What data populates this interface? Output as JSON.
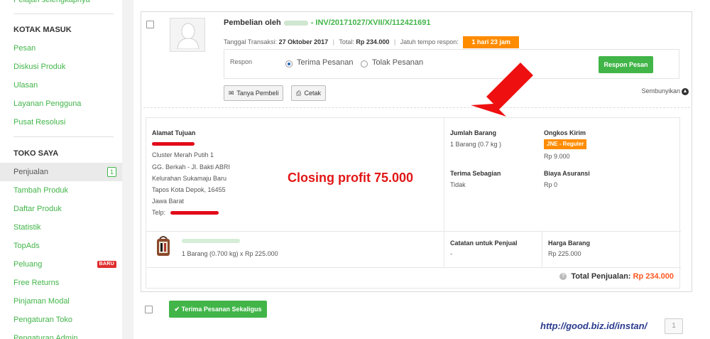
{
  "sidebar": {
    "top_link": "Pelajari selengkapnya",
    "inbox": {
      "heading": "KOTAK MASUK",
      "items": [
        "Pesan",
        "Diskusi Produk",
        "Ulasan",
        "Layanan Pengguna",
        "Pusat Resolusi"
      ]
    },
    "shop": {
      "heading": "TOKO SAYA",
      "items": [
        {
          "label": "Penjualan",
          "badge": "1"
        },
        {
          "label": "Tambah Produk"
        },
        {
          "label": "Daftar Produk"
        },
        {
          "label": "Statistik"
        },
        {
          "label": "TopAds"
        },
        {
          "label": "Peluang",
          "badge_new": "BARU"
        },
        {
          "label": "Free Returns"
        },
        {
          "label": "Pinjaman Modal"
        },
        {
          "label": "Pengaturan Toko"
        },
        {
          "label": "Pengaturan Admin"
        }
      ]
    }
  },
  "order": {
    "buyer_prefix": "Pembelian oleh",
    "invoice": "- INV/20171027/XVII/X/112421691",
    "trx_label": "Tanggal Transaksi:",
    "trx_date": "27 Oktober 2017",
    "total_label": "Total:",
    "total_value": "Rp 234.000",
    "due_label": "Jatuh tempo respon:",
    "due_value": "1 hari 23 jam",
    "respon_label": "Respon",
    "accept_label": "Terima Pesanan",
    "reject_label": "Tolak Pesanan",
    "respond_button": "Respon Pesan",
    "ask_button": "Tanya Pembeli",
    "print_button": "Cetak",
    "hide_link": "Sembunyikan"
  },
  "address": {
    "heading": "Alamat Tujuan",
    "lines": [
      "Cluster Merah Putih 1",
      "GG. Berkah - Jl. Bakti ABRI",
      "Kelurahan Sukamaju Baru",
      "Tapos Kota Depok, 16455",
      "Jawa Barat"
    ],
    "phone_label": "Telp:"
  },
  "shipping": {
    "qty_label": "Jumlah Barang",
    "qty_value": "1 Barang (0.7 kg )",
    "cost_label": "Ongkos Kirim",
    "courier": "JNE - Reguler",
    "cost_value": "Rp 9.000",
    "partial_label": "Terima Sebagian",
    "partial_value": "Tidak",
    "insurance_label": "Biaya Asuransi",
    "insurance_value": "Rp 0"
  },
  "product": {
    "qty_line": "1 Barang (0.700 kg) x Rp 225.000",
    "note_label": "Catatan untuk Penjual",
    "note_value": "-",
    "price_label": "Harga Barang",
    "price_value": "Rp 225.000"
  },
  "sales_total": {
    "label": "Total Penjualan:",
    "value": "Rp 234.000"
  },
  "annotation": "Closing profit 75.000",
  "bulk_accept_button": "Terima Pesanan Sekaligus",
  "watermark": "http://good.biz.id/instan/",
  "pagination": "1",
  "colors": {
    "brand_green": "#42b549",
    "orange": "#ff8c00",
    "total_orange": "#ff5722",
    "annotation_red": "#e21616"
  }
}
